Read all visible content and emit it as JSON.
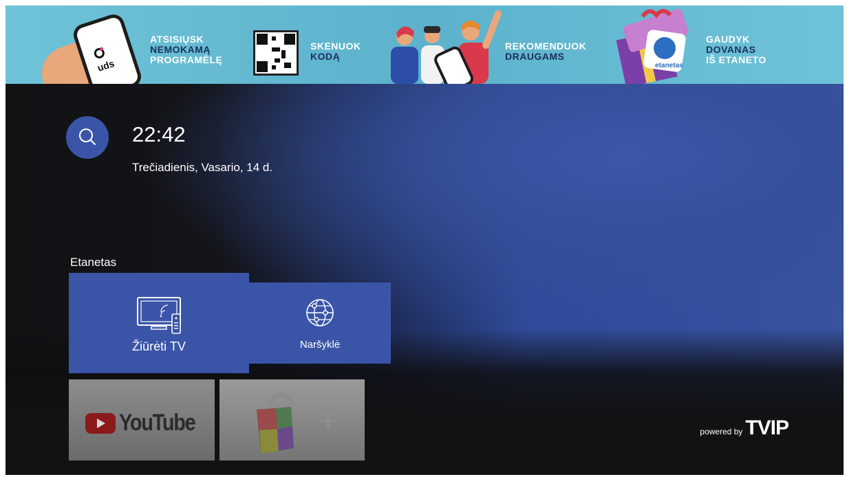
{
  "banner": {
    "step1": [
      "ATSISIŲSK",
      "NEMOKAMĄ",
      "PROGRAMĖLĘ"
    ],
    "step2": [
      "SKENUOK",
      "KODĄ"
    ],
    "step3": [
      "REKOMENDUOK",
      "DRAUGAMS"
    ],
    "step4": [
      "GAUDYK",
      "DOVANAS",
      "IŠ ETANETO"
    ],
    "uds_logo": "uds",
    "etanetas_logo": "etanetas",
    "accent_color": "#6fc3d8"
  },
  "header": {
    "search_icon": "search-icon",
    "time": "22:42",
    "date": "Trečiadienis, Vasario, 14 d."
  },
  "section": {
    "title": "Etanetas",
    "tiles": [
      {
        "label": "Žiūrėti TV",
        "icon": "tv-icon"
      },
      {
        "label": "Naršyklė",
        "icon": "globe-icon"
      }
    ]
  },
  "apps": [
    {
      "name": "YouTube",
      "icon": "youtube-icon"
    },
    {
      "name": "",
      "icon": "app-store-icon"
    }
  ],
  "footer": {
    "powered_by": "powered by",
    "brand": "TVIP"
  },
  "colors": {
    "tile_blue": "#3a55a8",
    "background_dark": "#121214"
  }
}
